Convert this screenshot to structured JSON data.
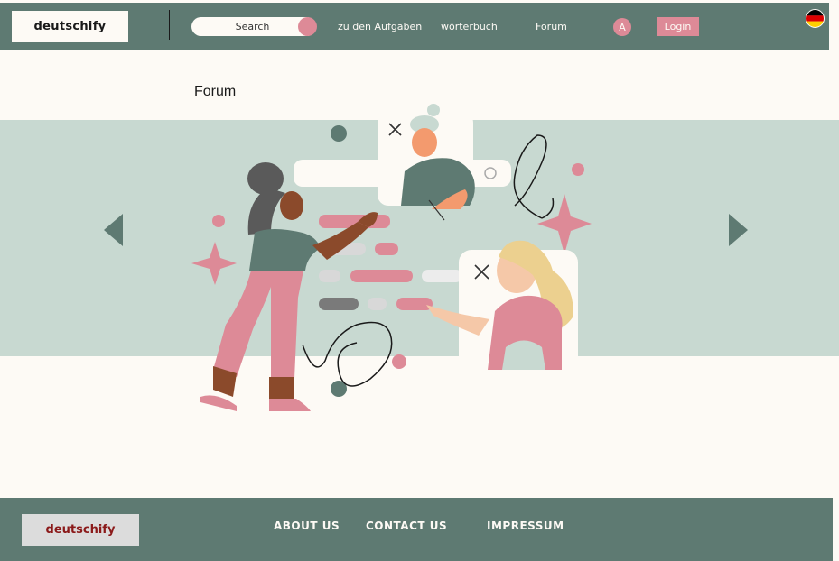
{
  "header": {
    "logo": "deutschify",
    "search_label": "Search",
    "nav": [
      "zu den Aufgaben",
      "wörterbuch",
      "Forum"
    ],
    "avatar_initial": "A",
    "login_label": "Login",
    "flag_icon": "german-flag-icon"
  },
  "page": {
    "title": "Forum"
  },
  "carousel": {
    "prev_icon": "chevron-left-icon",
    "next_icon": "chevron-right-icon",
    "image": "forum-chat-illustration"
  },
  "footer": {
    "logo": "deutschify",
    "links": [
      "ABOUT US",
      "CONTACT US",
      "IMPRESSUM"
    ]
  },
  "colors": {
    "primary": "#5e7a72",
    "accent": "#dd8a97",
    "background": "#fdfaf5",
    "band": "#c8d9d1",
    "footer_logo_text": "#8b1a1a"
  }
}
